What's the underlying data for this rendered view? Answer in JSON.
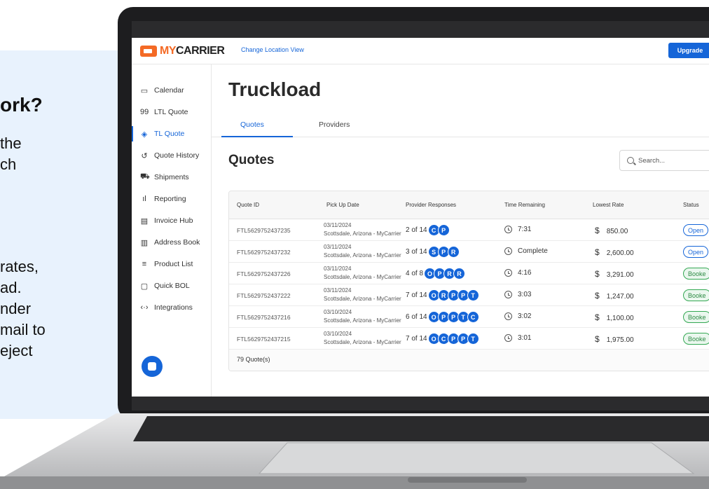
{
  "promo": {
    "title": "ork?",
    "lines": [
      "the",
      "ch",
      "rates,",
      "ad.",
      "nder",
      "mail to",
      "eject"
    ]
  },
  "header": {
    "logo_prefix": "MY",
    "logo_suffix": "CARRIER",
    "change_location": "Change Location View",
    "upgrade": "Upgrade"
  },
  "sidebar": {
    "items": [
      {
        "label": "Calendar",
        "icon": "calendar-icon",
        "glyph": "▭"
      },
      {
        "label": "LTL Quote",
        "icon": "ltl-quote-icon",
        "glyph": "99"
      },
      {
        "label": "TL Quote",
        "icon": "box-icon",
        "glyph": "◈"
      },
      {
        "label": "Quote History",
        "icon": "history-icon",
        "glyph": "↺"
      },
      {
        "label": "Shipments",
        "icon": "truck-icon",
        "glyph": "⛟"
      },
      {
        "label": "Reporting",
        "icon": "bar-chart-icon",
        "glyph": "ıl"
      },
      {
        "label": "Invoice Hub",
        "icon": "invoice-icon",
        "glyph": "▤"
      },
      {
        "label": "Address Book",
        "icon": "book-icon",
        "glyph": "▥"
      },
      {
        "label": "Product List",
        "icon": "list-icon",
        "glyph": "≡"
      },
      {
        "label": "Quick BOL",
        "icon": "document-icon",
        "glyph": "▢"
      },
      {
        "label": "Integrations",
        "icon": "code-icon",
        "glyph": "‹·›"
      }
    ],
    "active_index": 2
  },
  "main": {
    "title": "Truckload",
    "tabs": [
      "Quotes",
      "Providers"
    ],
    "section_title": "Quotes",
    "search_placeholder": "Search..."
  },
  "table": {
    "columns": [
      "Quote ID",
      "Pick Up Date",
      "Provider Responses",
      "Time Remaining",
      "Lowest Rate",
      "Status"
    ],
    "rows": [
      {
        "id": "FTL5629752437235",
        "date": "03/11/2024",
        "location": "Scottsdale, Arizona - MyCarrier",
        "responses": "2 of 14",
        "providers": [
          "C",
          "P"
        ],
        "time": "7:31",
        "rate": "850.00",
        "status": "Open"
      },
      {
        "id": "FTL5629752437232",
        "date": "03/11/2024",
        "location": "Scottsdale, Arizona - MyCarrier",
        "responses": "3 of 14",
        "providers": [
          "S",
          "P",
          "R"
        ],
        "time": "Complete",
        "rate": "2,600.00",
        "status": "Open"
      },
      {
        "id": "FTL5629752437226",
        "date": "03/11/2024",
        "location": "Scottsdale, Arizona - MyCarrier",
        "responses": "4 of 8",
        "providers": [
          "O",
          "P",
          "R",
          "R"
        ],
        "time": "4:16",
        "rate": "3,291.00",
        "status": "Booke"
      },
      {
        "id": "FTL5629752437222",
        "date": "03/11/2024",
        "location": "Scottsdale, Arizona - MyCarrier",
        "responses": "7 of 14",
        "providers": [
          "O",
          "R",
          "P",
          "P",
          "T"
        ],
        "time": "3:03",
        "rate": "1,247.00",
        "status": "Booke"
      },
      {
        "id": "FTL5629752437216",
        "date": "03/10/2024",
        "location": "Scottsdale, Arizona - MyCarrier",
        "responses": "6 of 14",
        "providers": [
          "O",
          "P",
          "P",
          "T",
          "C"
        ],
        "time": "3:02",
        "rate": "1,100.00",
        "status": "Booke"
      },
      {
        "id": "FTL5629752437215",
        "date": "03/10/2024",
        "location": "Scottsdale, Arizona - MyCarrier",
        "responses": "7 of 14",
        "providers": [
          "O",
          "C",
          "P",
          "P",
          "T"
        ],
        "time": "3:01",
        "rate": "1,975.00",
        "status": "Booke"
      }
    ],
    "footer": "79 Quote(s)",
    "currency_symbol": "$"
  },
  "colors": {
    "accent": "#1565d8",
    "brand": "#f46a25",
    "booked": "#34a853"
  }
}
